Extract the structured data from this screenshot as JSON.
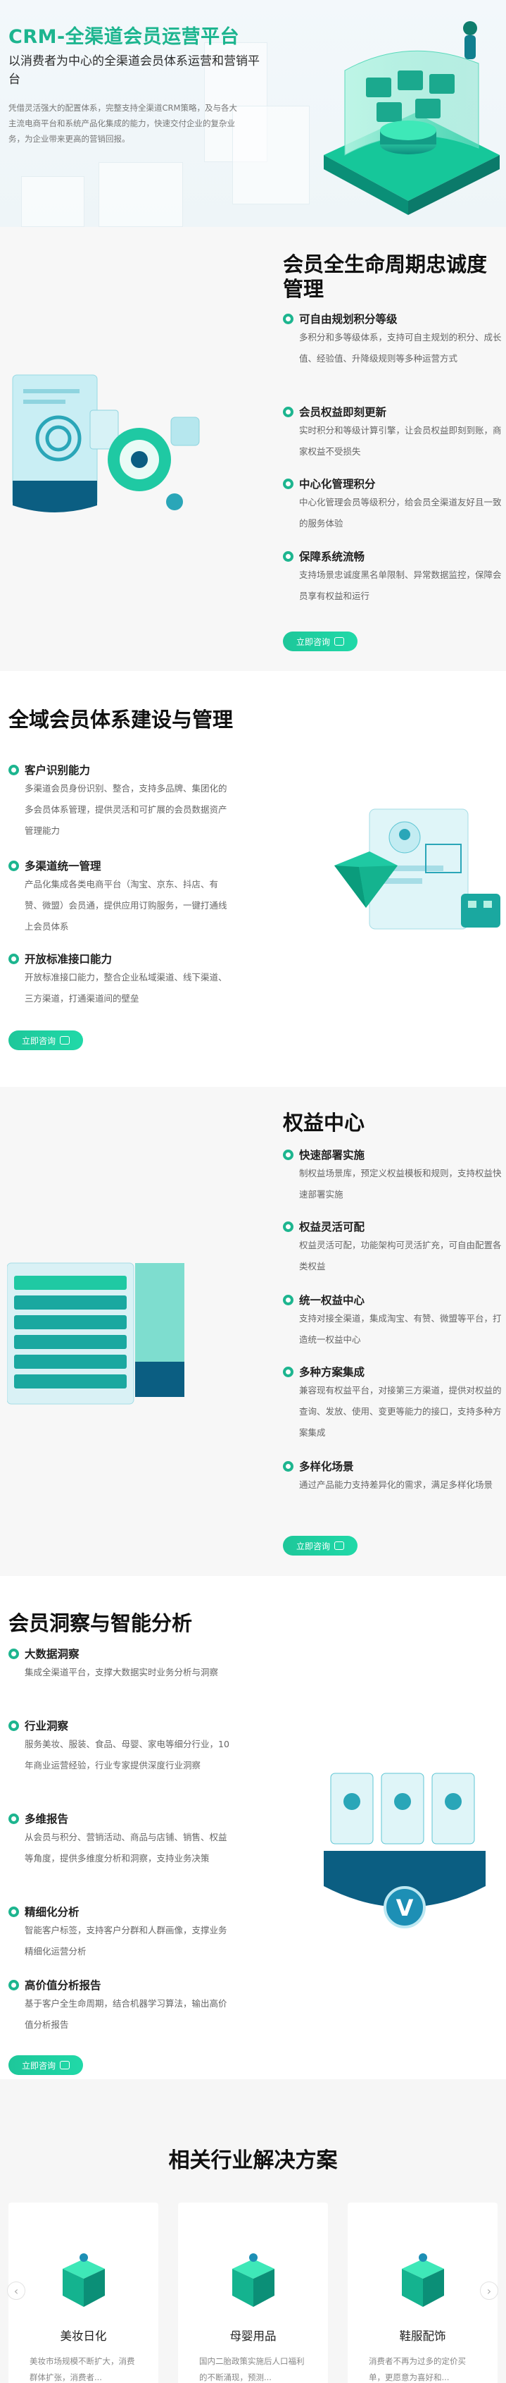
{
  "hero": {
    "title": "CRM-全渠道会员运营平台",
    "subtitle": "以消费者为中心的全渠道会员体系运营和营销平台",
    "desc": "凭借灵活强大的配置体系，完整支持全渠道CRM策略，及与各大主流电商平台和系统产品化集成的能力，快速交付企业的复杂业务，为企业带来更高的营销回报。"
  },
  "cta_label": "立即咨询",
  "sections": [
    {
      "title": "会员全生命周期忠诚度管理",
      "features": [
        {
          "title": "可自由规划积分等级",
          "desc": "多积分和多等级体系，支持可自主规划的积分、成长值、经验值、升降级规则等多种运营方式"
        },
        {
          "title": "会员权益即刻更新",
          "desc": "实时积分和等级计算引擎，让会员权益即刻到账，商家权益不受损失"
        },
        {
          "title": "中心化管理积分",
          "desc": "中心化管理会员等级积分，给会员全渠道友好且一致的服务体验"
        },
        {
          "title": "保障系统流畅",
          "desc": "支持场景忠诚度黑名单限制、异常数据监控，保障会员享有权益和运行"
        }
      ]
    },
    {
      "title": "全域会员体系建设与管理",
      "features": [
        {
          "title": "客户识别能力",
          "desc": "多渠道会员身份识别、整合，支持多品牌、集团化的多会员体系管理，提供灵活和可扩展的会员数据资产管理能力"
        },
        {
          "title": "多渠道统一管理",
          "desc": "产品化集成各类电商平台（淘宝、京东、抖店、有赞、微盟）会员通，提供应用订购服务，一键打通线上会员体系"
        },
        {
          "title": "开放标准接口能力",
          "desc": "开放标准接口能力，整合企业私域渠道、线下渠道、三方渠道，打通渠道间的壁垒"
        }
      ]
    },
    {
      "title": "权益中心",
      "features": [
        {
          "title": "快速部署实施",
          "desc": "制权益场景库，预定义权益模板和规则，支持权益快速部署实施"
        },
        {
          "title": "权益灵活可配",
          "desc": "权益灵活可配，功能架构可灵活扩充，可自由配置各类权益"
        },
        {
          "title": "统一权益中心",
          "desc": "支持对接全渠道，集成淘宝、有赞、微盟等平台，打造统一权益中心"
        },
        {
          "title": "多种方案集成",
          "desc": "兼容现有权益平台，对接第三方渠道，提供对权益的查询、发放、使用、变更等能力的接口，支持多种方案集成"
        },
        {
          "title": "多样化场景",
          "desc": "通过产品能力支持差异化的需求，满足多样化场景"
        }
      ]
    },
    {
      "title": "会员洞察与智能分析",
      "features": [
        {
          "title": "大数据洞察",
          "desc": "集成全渠道平台，支撑大数据实时业务分析与洞察"
        },
        {
          "title": "行业洞察",
          "desc": "服务美妆、服装、食品、母婴、家电等细分行业，10年商业运营经验，行业专家提供深度行业洞察"
        },
        {
          "title": "多维报告",
          "desc": "从会员与积分、营销活动、商品与店铺、销售、权益等角度，提供多维度分析和洞察，支持业务决策"
        },
        {
          "title": "精细化分析",
          "desc": "智能客户标签，支持客户分群和人群画像，支撑业务精细化运营分析"
        },
        {
          "title": "高价值分析报告",
          "desc": "基于客户全生命周期，结合机器学习算法，输出高价值分析报告"
        }
      ]
    }
  ],
  "industry": {
    "title": "相关行业解决方案",
    "cards": [
      {
        "name": "美妆日化",
        "desc": "美妆市场规模不断扩大，消费群体扩张，消费者..."
      },
      {
        "name": "母婴用品",
        "desc": "国内二胎政策实施后人口福利的不断涌现，预测..."
      },
      {
        "name": "鞋服配饰",
        "desc": "消费者不再为过多的定价买单，更愿意为喜好和..."
      }
    ],
    "prev_icon": "chevron-left-icon",
    "next_icon": "chevron-right-icon"
  },
  "colors": {
    "accent": "#1db58f",
    "accent_light": "#20d9a8",
    "dark_teal": "#0b5e82"
  }
}
